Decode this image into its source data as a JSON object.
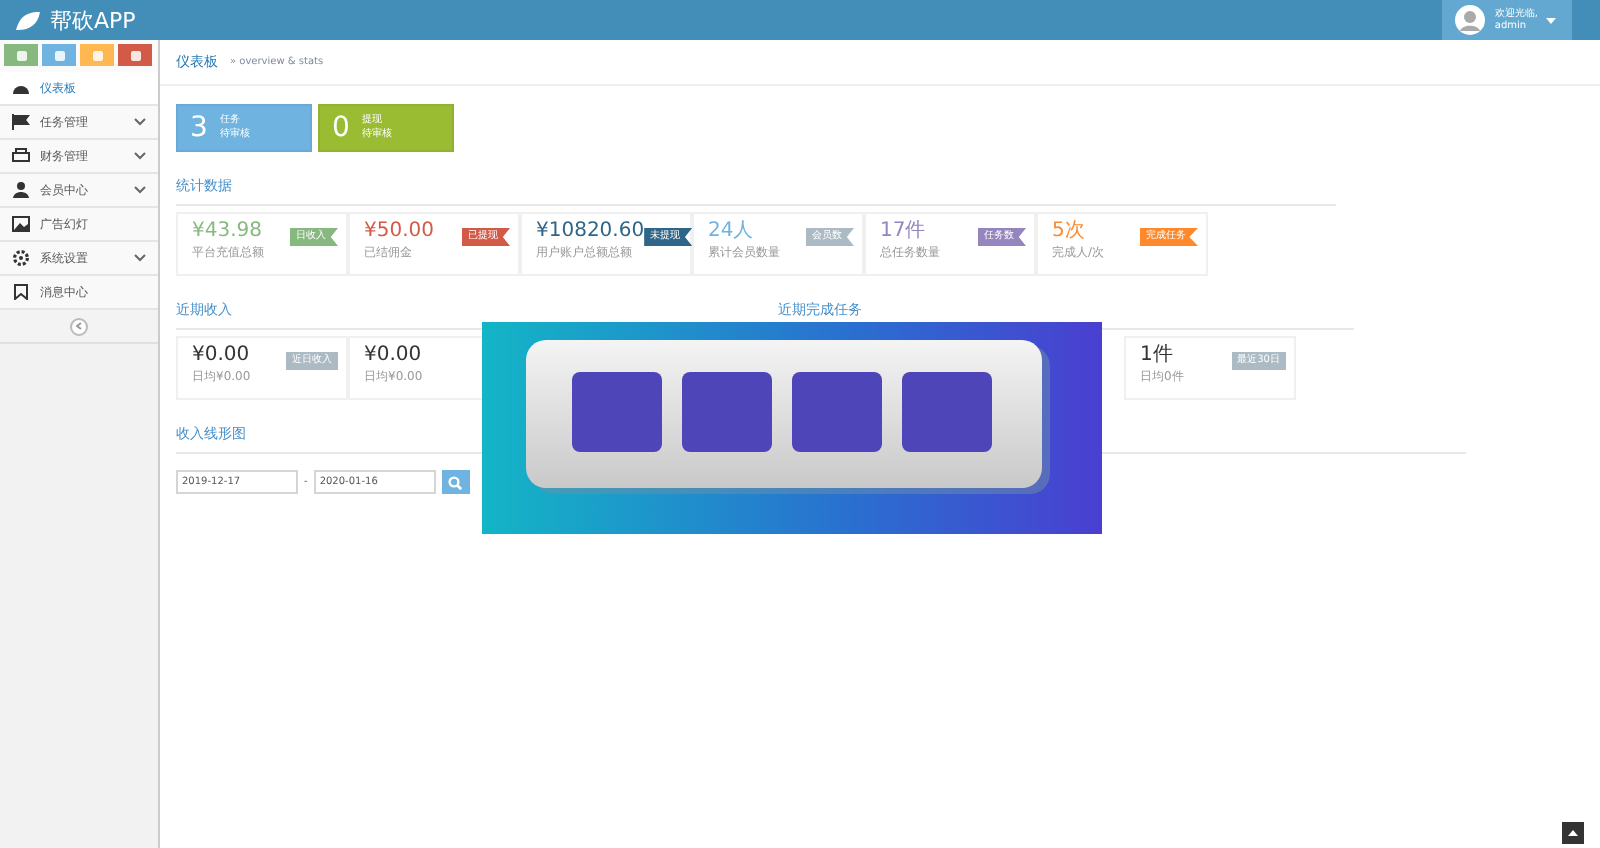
{
  "header": {
    "brand": "帮砍APP",
    "greeting": "欢迎光临,",
    "user": "admin"
  },
  "shortcuts": [
    {
      "color": "#87b87f"
    },
    {
      "color": "#6fb3e0"
    },
    {
      "color": "#ffb752"
    },
    {
      "color": "#d15b47"
    }
  ],
  "sidebar": {
    "items": [
      {
        "label": "仪表板",
        "has_children": false,
        "selected": true
      },
      {
        "label": "任务管理",
        "has_children": true,
        "selected": false
      },
      {
        "label": "财务管理",
        "has_children": true,
        "selected": false
      },
      {
        "label": "会员中心",
        "has_children": true,
        "selected": false
      },
      {
        "label": "广告幻灯",
        "has_children": false,
        "selected": false
      },
      {
        "label": "系统设置",
        "has_children": true,
        "selected": false
      },
      {
        "label": "消息中心",
        "has_children": false,
        "selected": false
      }
    ]
  },
  "breadcrumb": {
    "title": "仪表板",
    "subtitle": "» overview & stats"
  },
  "infoboxes": [
    {
      "number": "3",
      "line1": "任务",
      "line2": "待审核",
      "color": "#6fb3e0"
    },
    {
      "number": "0",
      "line1": "提现",
      "line2": "待审核",
      "color": "#9abc32"
    }
  ],
  "stats": {
    "title": "统计数据",
    "cards": [
      {
        "value": "¥43.98",
        "caption": "平台充值总额",
        "tag": "日收入",
        "color": "#87b87f"
      },
      {
        "value": "¥50.00",
        "caption": "已结佣金",
        "tag": "已提现",
        "color": "#d15b47"
      },
      {
        "value": "¥10820.60",
        "caption": "用户账户总额总额",
        "tag": "未提现",
        "color": "#2e6589"
      },
      {
        "value": "24人",
        "caption": "累计会员数量",
        "tag": "会员数",
        "color": "#abbac3"
      },
      {
        "value": "17件",
        "caption": "总任务数量",
        "tag": "任务数",
        "color": "#9585bf"
      },
      {
        "value": "5次",
        "caption": "完成人/次",
        "tag": "完成任务",
        "color": "#ff892a"
      }
    ]
  },
  "recent_income": {
    "title": "近期收入",
    "cards": [
      {
        "value": "¥0.00",
        "caption": "日均¥0.00",
        "tag": "近日收入"
      },
      {
        "value": "¥0.00",
        "caption": "日均¥0.00"
      }
    ]
  },
  "recent_tasks": {
    "title": "近期完成任务",
    "cards": [
      {
        "value": "1件",
        "caption": "日均0件",
        "tag": "最近30日"
      }
    ]
  },
  "chart_section": {
    "title": "收入线形图",
    "date_from": "2019-12-17",
    "separator": "-",
    "date_to": "2020-01-16"
  }
}
